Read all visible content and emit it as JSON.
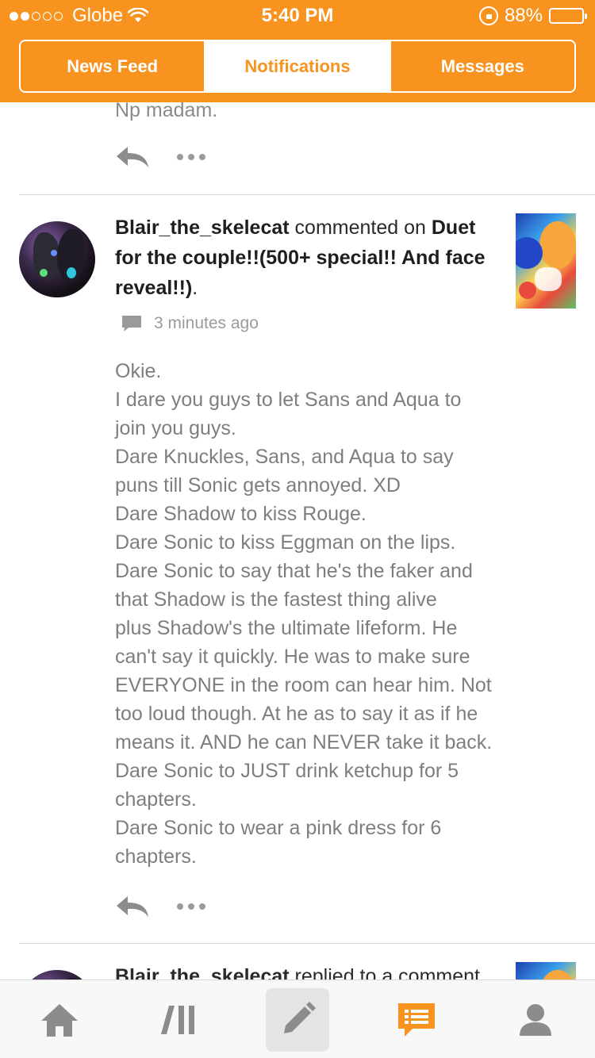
{
  "status_bar": {
    "carrier": "Globe",
    "time": "5:40 PM",
    "battery": "88%",
    "battery_level": 0.88,
    "signal_bars_filled": 2,
    "signal_bars_total": 5
  },
  "tabs": [
    {
      "label": "News Feed",
      "active": false
    },
    {
      "label": "Notifications",
      "active": true
    },
    {
      "label": "Messages",
      "active": false
    }
  ],
  "previous_item": {
    "text": "Np madam."
  },
  "notification": {
    "username": "Blair_the_skelecat",
    "action": "commented on",
    "post_title": "Duet for the couple!!(500+ special!! And face reveal!!)",
    "post_title_line1": "Duet",
    "post_title_line2": "for the couple!!(500+ special!! And face",
    "post_title_line3": "reveal!!)",
    "period": ".",
    "timestamp": "3 minutes ago",
    "comment_lines": [
      "Okie.",
      "I dare you guys to let Sans and Aqua to",
      "join you guys.",
      "Dare Knuckles, Sans, and Aqua to say",
      "puns till Sonic gets annoyed. XD",
      "Dare Shadow to kiss Rouge.",
      "Dare Sonic to kiss Eggman on the lips.",
      "Dare Sonic to say that he's the faker and",
      "that Shadow is the fastest thing alive",
      "plus Shadow's the ultimate lifeform. He",
      "can't say it quickly. He was to make sure",
      "EVERYONE in the room can hear him. Not",
      "too loud though. At he as to say it as if he",
      "means it. AND he can NEVER take it back.",
      "Dare Sonic to JUST drink ketchup for 5",
      "chapters.",
      "Dare Sonic to wear a pink dress for 6",
      "chapters."
    ]
  },
  "next_item": {
    "username": "Blair_the_skelecat",
    "action": "replied to a comment"
  },
  "bottom_bar": [
    {
      "icon": "home-icon"
    },
    {
      "icon": "feed-icon"
    },
    {
      "icon": "compose-icon"
    },
    {
      "icon": "notifications-icon"
    },
    {
      "icon": "profile-icon"
    }
  ],
  "colors": {
    "accent": "#f7931e",
    "text_dark": "#2a2a2a",
    "text_muted": "#7e7e7e",
    "icon_gray": "#8c8c8c"
  }
}
